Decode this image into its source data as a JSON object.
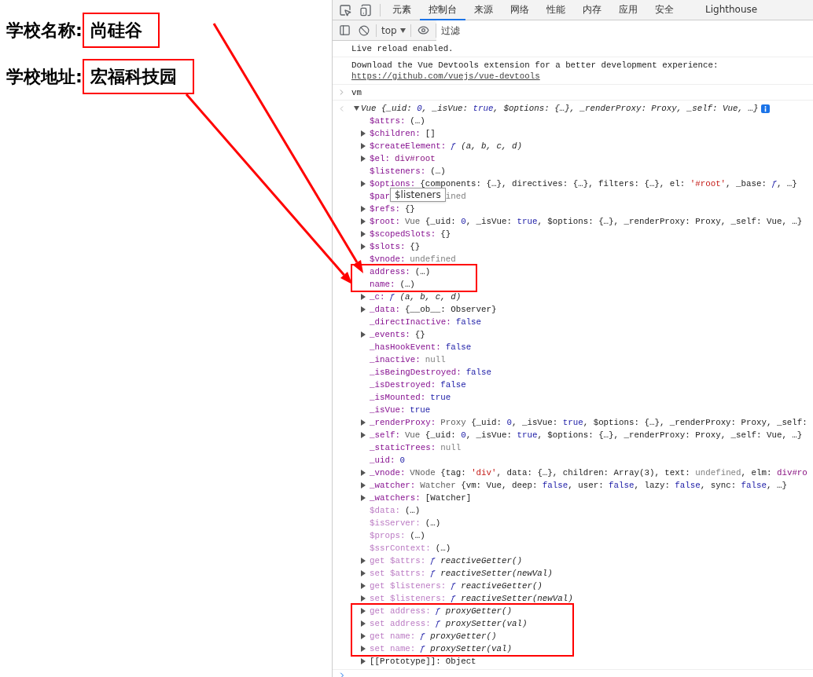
{
  "page": {
    "fields": [
      {
        "label": "学校名称:",
        "value": "尚硅谷"
      },
      {
        "label": "学校地址:",
        "value": "宏福科技园"
      }
    ]
  },
  "devtools": {
    "tabs": [
      {
        "label": "元素",
        "selected": false
      },
      {
        "label": "控制台",
        "selected": true
      },
      {
        "label": "来源",
        "selected": false
      },
      {
        "label": "网络",
        "selected": false
      },
      {
        "label": "性能",
        "selected": false
      },
      {
        "label": "内存",
        "selected": false
      },
      {
        "label": "应用",
        "selected": false
      },
      {
        "label": "安全",
        "selected": false
      },
      {
        "label": "Lighthouse",
        "selected": false
      }
    ],
    "context": "top",
    "filter": {
      "placeholder": "过滤"
    },
    "messages": [
      {
        "text": "Live reload enabled."
      },
      {
        "text": "Download the Vue Devtools extension for a better development experience:",
        "link": "https://github.com/vuejs/vue-devtools"
      }
    ],
    "command": "vm",
    "result": {
      "expanded": true,
      "header": [
        {
          "text": "Vue {_uid: ",
          "kind": "plain"
        },
        {
          "text": "0",
          "kind": "kw"
        },
        {
          "text": ", _isVue: ",
          "kind": "plain"
        },
        {
          "text": "true",
          "kind": "kw"
        },
        {
          "text": ", $options: {…}, _renderProxy: Proxy, _self: Vue, …}",
          "kind": "plain"
        }
      ],
      "properties": [
        {
          "key": "$attrs:",
          "kind": "own",
          "expandable": false,
          "highlighted": false,
          "value": [
            {
              "text": "(…)",
              "kind": "plain"
            }
          ]
        },
        {
          "key": "$children:",
          "kind": "own",
          "expandable": true,
          "highlighted": false,
          "value": [
            {
              "text": "[]",
              "kind": "plain"
            }
          ]
        },
        {
          "key": "$createElement:",
          "kind": "own",
          "expandable": true,
          "highlighted": false,
          "value": [
            {
              "text": "ƒ",
              "kind": "fsym"
            },
            {
              "text": " (a, b, c, d)",
              "kind": "fn"
            }
          ]
        },
        {
          "key": "$el:",
          "kind": "own",
          "expandable": true,
          "highlighted": false,
          "value": [
            {
              "text": "div#root",
              "kind": "tag"
            }
          ]
        },
        {
          "key": "$listeners:",
          "kind": "own",
          "expandable": false,
          "highlighted": false,
          "value": [
            {
              "text": "(…)",
              "kind": "plain"
            }
          ]
        },
        {
          "key": "$options:",
          "kind": "own",
          "expandable": true,
          "highlighted": false,
          "value": [
            {
              "text": "{components: {…}, directives: {…}, filters: {…}, el: ",
              "kind": "plain"
            },
            {
              "text": "'#root'",
              "kind": "str"
            },
            {
              "text": ", _base: ",
              "kind": "plain"
            },
            {
              "text": "ƒ",
              "kind": "fsym"
            },
            {
              "text": ", …}",
              "kind": "plain"
            }
          ]
        },
        {
          "key": "$par",
          "kind": "own",
          "expandable": false,
          "highlighted": false,
          "tooltip": "$listeners",
          "value": [
            {
              "text": "ined",
              "kind": "null"
            }
          ]
        },
        {
          "key": "$refs:",
          "kind": "own",
          "expandable": true,
          "highlighted": false,
          "value": [
            {
              "text": "{}",
              "kind": "plain"
            }
          ]
        },
        {
          "key": "$root:",
          "kind": "own",
          "expandable": true,
          "highlighted": false,
          "value": [
            {
              "text": "Vue ",
              "kind": "cls"
            },
            {
              "text": "{_uid: ",
              "kind": "plain"
            },
            {
              "text": "0",
              "kind": "kw"
            },
            {
              "text": ", _isVue: ",
              "kind": "plain"
            },
            {
              "text": "true",
              "kind": "kw"
            },
            {
              "text": ", $options: {…}, _renderProxy: Proxy, _self: Vue, …}",
              "kind": "plain"
            }
          ]
        },
        {
          "key": "$scopedSlots:",
          "kind": "own",
          "expandable": true,
          "highlighted": false,
          "value": [
            {
              "text": "{}",
              "kind": "plain"
            }
          ]
        },
        {
          "key": "$slots:",
          "kind": "own",
          "expandable": true,
          "highlighted": false,
          "value": [
            {
              "text": "{}",
              "kind": "plain"
            }
          ]
        },
        {
          "key": "$vnode:",
          "kind": "own",
          "expandable": false,
          "highlighted": false,
          "value": [
            {
              "text": "undefined",
              "kind": "null"
            }
          ]
        },
        {
          "key": "address:",
          "kind": "own",
          "expandable": false,
          "highlighted": true,
          "value": [
            {
              "text": "(…)",
              "kind": "plain"
            }
          ]
        },
        {
          "key": "name:",
          "kind": "own",
          "expandable": false,
          "highlighted": true,
          "value": [
            {
              "text": "(…)",
              "kind": "plain"
            }
          ]
        },
        {
          "key": "_c:",
          "kind": "own",
          "expandable": true,
          "highlighted": false,
          "value": [
            {
              "text": "ƒ",
              "kind": "fsym"
            },
            {
              "text": " (a, b, c, d)",
              "kind": "fn"
            }
          ]
        },
        {
          "key": "_data:",
          "kind": "own",
          "expandable": true,
          "highlighted": false,
          "value": [
            {
              "text": "{__ob__: Observer}",
              "kind": "plain"
            }
          ]
        },
        {
          "key": "_directInactive:",
          "kind": "own",
          "expandable": false,
          "highlighted": false,
          "value": [
            {
              "text": "false",
              "kind": "kw"
            }
          ]
        },
        {
          "key": "_events:",
          "kind": "own",
          "expandable": true,
          "highlighted": false,
          "value": [
            {
              "text": "{}",
              "kind": "plain"
            }
          ]
        },
        {
          "key": "_hasHookEvent:",
          "kind": "own",
          "expandable": false,
          "highlighted": false,
          "value": [
            {
              "text": "false",
              "kind": "kw"
            }
          ]
        },
        {
          "key": "_inactive:",
          "kind": "own",
          "expandable": false,
          "highlighted": false,
          "value": [
            {
              "text": "null",
              "kind": "null"
            }
          ]
        },
        {
          "key": "_isBeingDestroyed:",
          "kind": "own",
          "expandable": false,
          "highlighted": false,
          "value": [
            {
              "text": "false",
              "kind": "kw"
            }
          ]
        },
        {
          "key": "_isDestroyed:",
          "kind": "own",
          "expandable": false,
          "highlighted": false,
          "value": [
            {
              "text": "false",
              "kind": "kw"
            }
          ]
        },
        {
          "key": "_isMounted:",
          "kind": "own",
          "expandable": false,
          "highlighted": false,
          "value": [
            {
              "text": "true",
              "kind": "kw"
            }
          ]
        },
        {
          "key": "_isVue:",
          "kind": "own",
          "expandable": false,
          "highlighted": false,
          "value": [
            {
              "text": "true",
              "kind": "kw"
            }
          ]
        },
        {
          "key": "_renderProxy:",
          "kind": "own",
          "expandable": true,
          "highlighted": false,
          "value": [
            {
              "text": "Proxy ",
              "kind": "cls"
            },
            {
              "text": "{_uid: ",
              "kind": "plain"
            },
            {
              "text": "0",
              "kind": "kw"
            },
            {
              "text": ", _isVue: ",
              "kind": "plain"
            },
            {
              "text": "true",
              "kind": "kw"
            },
            {
              "text": ", $options: {…}, _renderProxy: Proxy, _self:",
              "kind": "plain"
            }
          ]
        },
        {
          "key": "_self:",
          "kind": "own",
          "expandable": true,
          "highlighted": false,
          "value": [
            {
              "text": "Vue ",
              "kind": "cls"
            },
            {
              "text": "{_uid: ",
              "kind": "plain"
            },
            {
              "text": "0",
              "kind": "kw"
            },
            {
              "text": ", _isVue: ",
              "kind": "plain"
            },
            {
              "text": "true",
              "kind": "kw"
            },
            {
              "text": ", $options: {…}, _renderProxy: Proxy, _self: Vue, …}",
              "kind": "plain"
            }
          ]
        },
        {
          "key": "_staticTrees:",
          "kind": "own",
          "expandable": false,
          "highlighted": false,
          "value": [
            {
              "text": "null",
              "kind": "null"
            }
          ]
        },
        {
          "key": "_uid:",
          "kind": "own",
          "expandable": false,
          "highlighted": false,
          "value": [
            {
              "text": "0",
              "kind": "kw"
            }
          ]
        },
        {
          "key": "_vnode:",
          "kind": "own",
          "expandable": true,
          "highlighted": false,
          "value": [
            {
              "text": "VNode ",
              "kind": "cls"
            },
            {
              "text": "{tag: ",
              "kind": "plain"
            },
            {
              "text": "'div'",
              "kind": "str"
            },
            {
              "text": ", data: {…}, children: Array(3), text: ",
              "kind": "plain"
            },
            {
              "text": "undefined",
              "kind": "null"
            },
            {
              "text": ", elm: ",
              "kind": "plain"
            },
            {
              "text": "div#ro",
              "kind": "tag"
            }
          ]
        },
        {
          "key": "_watcher:",
          "kind": "own",
          "expandable": true,
          "highlighted": false,
          "value": [
            {
              "text": "Watcher ",
              "kind": "cls"
            },
            {
              "text": "{vm: Vue, deep: ",
              "kind": "plain"
            },
            {
              "text": "false",
              "kind": "kw"
            },
            {
              "text": ", user: ",
              "kind": "plain"
            },
            {
              "text": "false",
              "kind": "kw"
            },
            {
              "text": ", lazy: ",
              "kind": "plain"
            },
            {
              "text": "false",
              "kind": "kw"
            },
            {
              "text": ", sync: ",
              "kind": "plain"
            },
            {
              "text": "false",
              "kind": "kw"
            },
            {
              "text": ", …}",
              "kind": "plain"
            }
          ]
        },
        {
          "key": "_watchers:",
          "kind": "own",
          "expandable": true,
          "highlighted": false,
          "value": [
            {
              "text": "[Watcher]",
              "kind": "plain"
            }
          ]
        },
        {
          "key": "$data:",
          "kind": "dim",
          "expandable": false,
          "highlighted": false,
          "value": [
            {
              "text": "(…)",
              "kind": "plain"
            }
          ]
        },
        {
          "key": "$isServer:",
          "kind": "dim",
          "expandable": false,
          "highlighted": false,
          "value": [
            {
              "text": "(…)",
              "kind": "plain"
            }
          ]
        },
        {
          "key": "$props:",
          "kind": "dim",
          "expandable": false,
          "highlighted": false,
          "value": [
            {
              "text": "(…)",
              "kind": "plain"
            }
          ]
        },
        {
          "key": "$ssrContext:",
          "kind": "dim",
          "expandable": false,
          "highlighted": false,
          "value": [
            {
              "text": "(…)",
              "kind": "plain"
            }
          ]
        },
        {
          "key": "get $attrs:",
          "kind": "dim",
          "expandable": true,
          "highlighted": false,
          "value": [
            {
              "text": "ƒ",
              "kind": "fsym"
            },
            {
              "text": " reactiveGetter()",
              "kind": "fn"
            }
          ]
        },
        {
          "key": "set $attrs:",
          "kind": "dim",
          "expandable": true,
          "highlighted": false,
          "value": [
            {
              "text": "ƒ",
              "kind": "fsym"
            },
            {
              "text": " reactiveSetter(newVal)",
              "kind": "fn"
            }
          ]
        },
        {
          "key": "get $listeners:",
          "kind": "dim",
          "expandable": true,
          "highlighted": false,
          "value": [
            {
              "text": "ƒ",
              "kind": "fsym"
            },
            {
              "text": " reactiveGetter()",
              "kind": "fn"
            }
          ]
        },
        {
          "key": "set $listeners:",
          "kind": "dim",
          "expandable": true,
          "highlighted": false,
          "value": [
            {
              "text": "ƒ",
              "kind": "fsym"
            },
            {
              "text": " reactiveSetter(newVal)",
              "kind": "fn"
            }
          ]
        },
        {
          "key": "get address:",
          "kind": "dim",
          "expandable": true,
          "highlighted": true,
          "value": [
            {
              "text": "ƒ",
              "kind": "fsym"
            },
            {
              "text": " proxyGetter()",
              "kind": "fn"
            }
          ]
        },
        {
          "key": "set address:",
          "kind": "dim",
          "expandable": true,
          "highlighted": true,
          "value": [
            {
              "text": "ƒ",
              "kind": "fsym"
            },
            {
              "text": " proxySetter(val)",
              "kind": "fn"
            }
          ]
        },
        {
          "key": "get name:",
          "kind": "dim",
          "expandable": true,
          "highlighted": true,
          "value": [
            {
              "text": "ƒ",
              "kind": "fsym"
            },
            {
              "text": " proxyGetter()",
              "kind": "fn"
            }
          ]
        },
        {
          "key": "set name:",
          "kind": "dim",
          "expandable": true,
          "highlighted": true,
          "value": [
            {
              "text": "ƒ",
              "kind": "fsym"
            },
            {
              "text": " proxySetter(val)",
              "kind": "fn"
            }
          ]
        },
        {
          "key": "[[Prototype]]:",
          "kind": "internal",
          "expandable": true,
          "highlighted": false,
          "value": [
            {
              "text": "Object",
              "kind": "plain"
            }
          ]
        }
      ]
    }
  }
}
